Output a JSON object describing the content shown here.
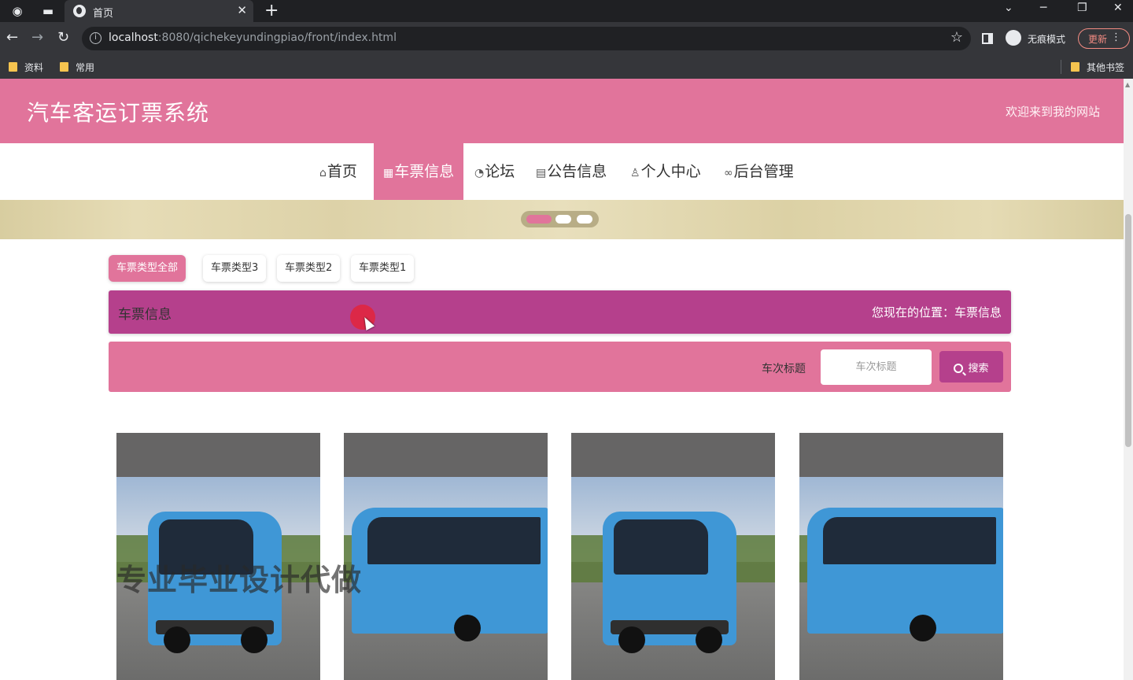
{
  "browser": {
    "tab_title": "首页",
    "url_host": "localhost",
    "url_rest": ":8080/qichekeyundingpiao/front/index.html",
    "incognito_label": "无痕模式",
    "update_label": "更新",
    "bookmarks": [
      {
        "label": "资料"
      },
      {
        "label": "常用"
      }
    ],
    "other_bookmarks": "其他书签"
  },
  "site": {
    "title": "汽车客运订票系统",
    "welcome": "欢迎来到我的网站",
    "nav": [
      {
        "label": "首页",
        "icon": "home-icon"
      },
      {
        "label": "车票信息",
        "icon": "ticket-icon"
      },
      {
        "label": "论坛",
        "icon": "palette-icon"
      },
      {
        "label": "公告信息",
        "icon": "clipboard-icon"
      },
      {
        "label": "个人中心",
        "icon": "user-icon"
      },
      {
        "label": "后台管理",
        "icon": "link-icon"
      }
    ],
    "nav_active_index": 1,
    "banner_dots": 3,
    "banner_active_index": 0
  },
  "filters": [
    {
      "label": "车票类型全部",
      "active": true
    },
    {
      "label": "车票类型3",
      "active": false
    },
    {
      "label": "车票类型2",
      "active": false
    },
    {
      "label": "车票类型1",
      "active": false
    }
  ],
  "breadcrumb": {
    "title": "车票信息",
    "position": "您现在的位置：车票信息"
  },
  "search": {
    "label": "车次标题",
    "placeholder": "车次标题",
    "button": "搜索"
  },
  "watermark": "专业毕业设计代做",
  "colors": {
    "primary": "#e1749b",
    "accent": "#b5408c"
  }
}
